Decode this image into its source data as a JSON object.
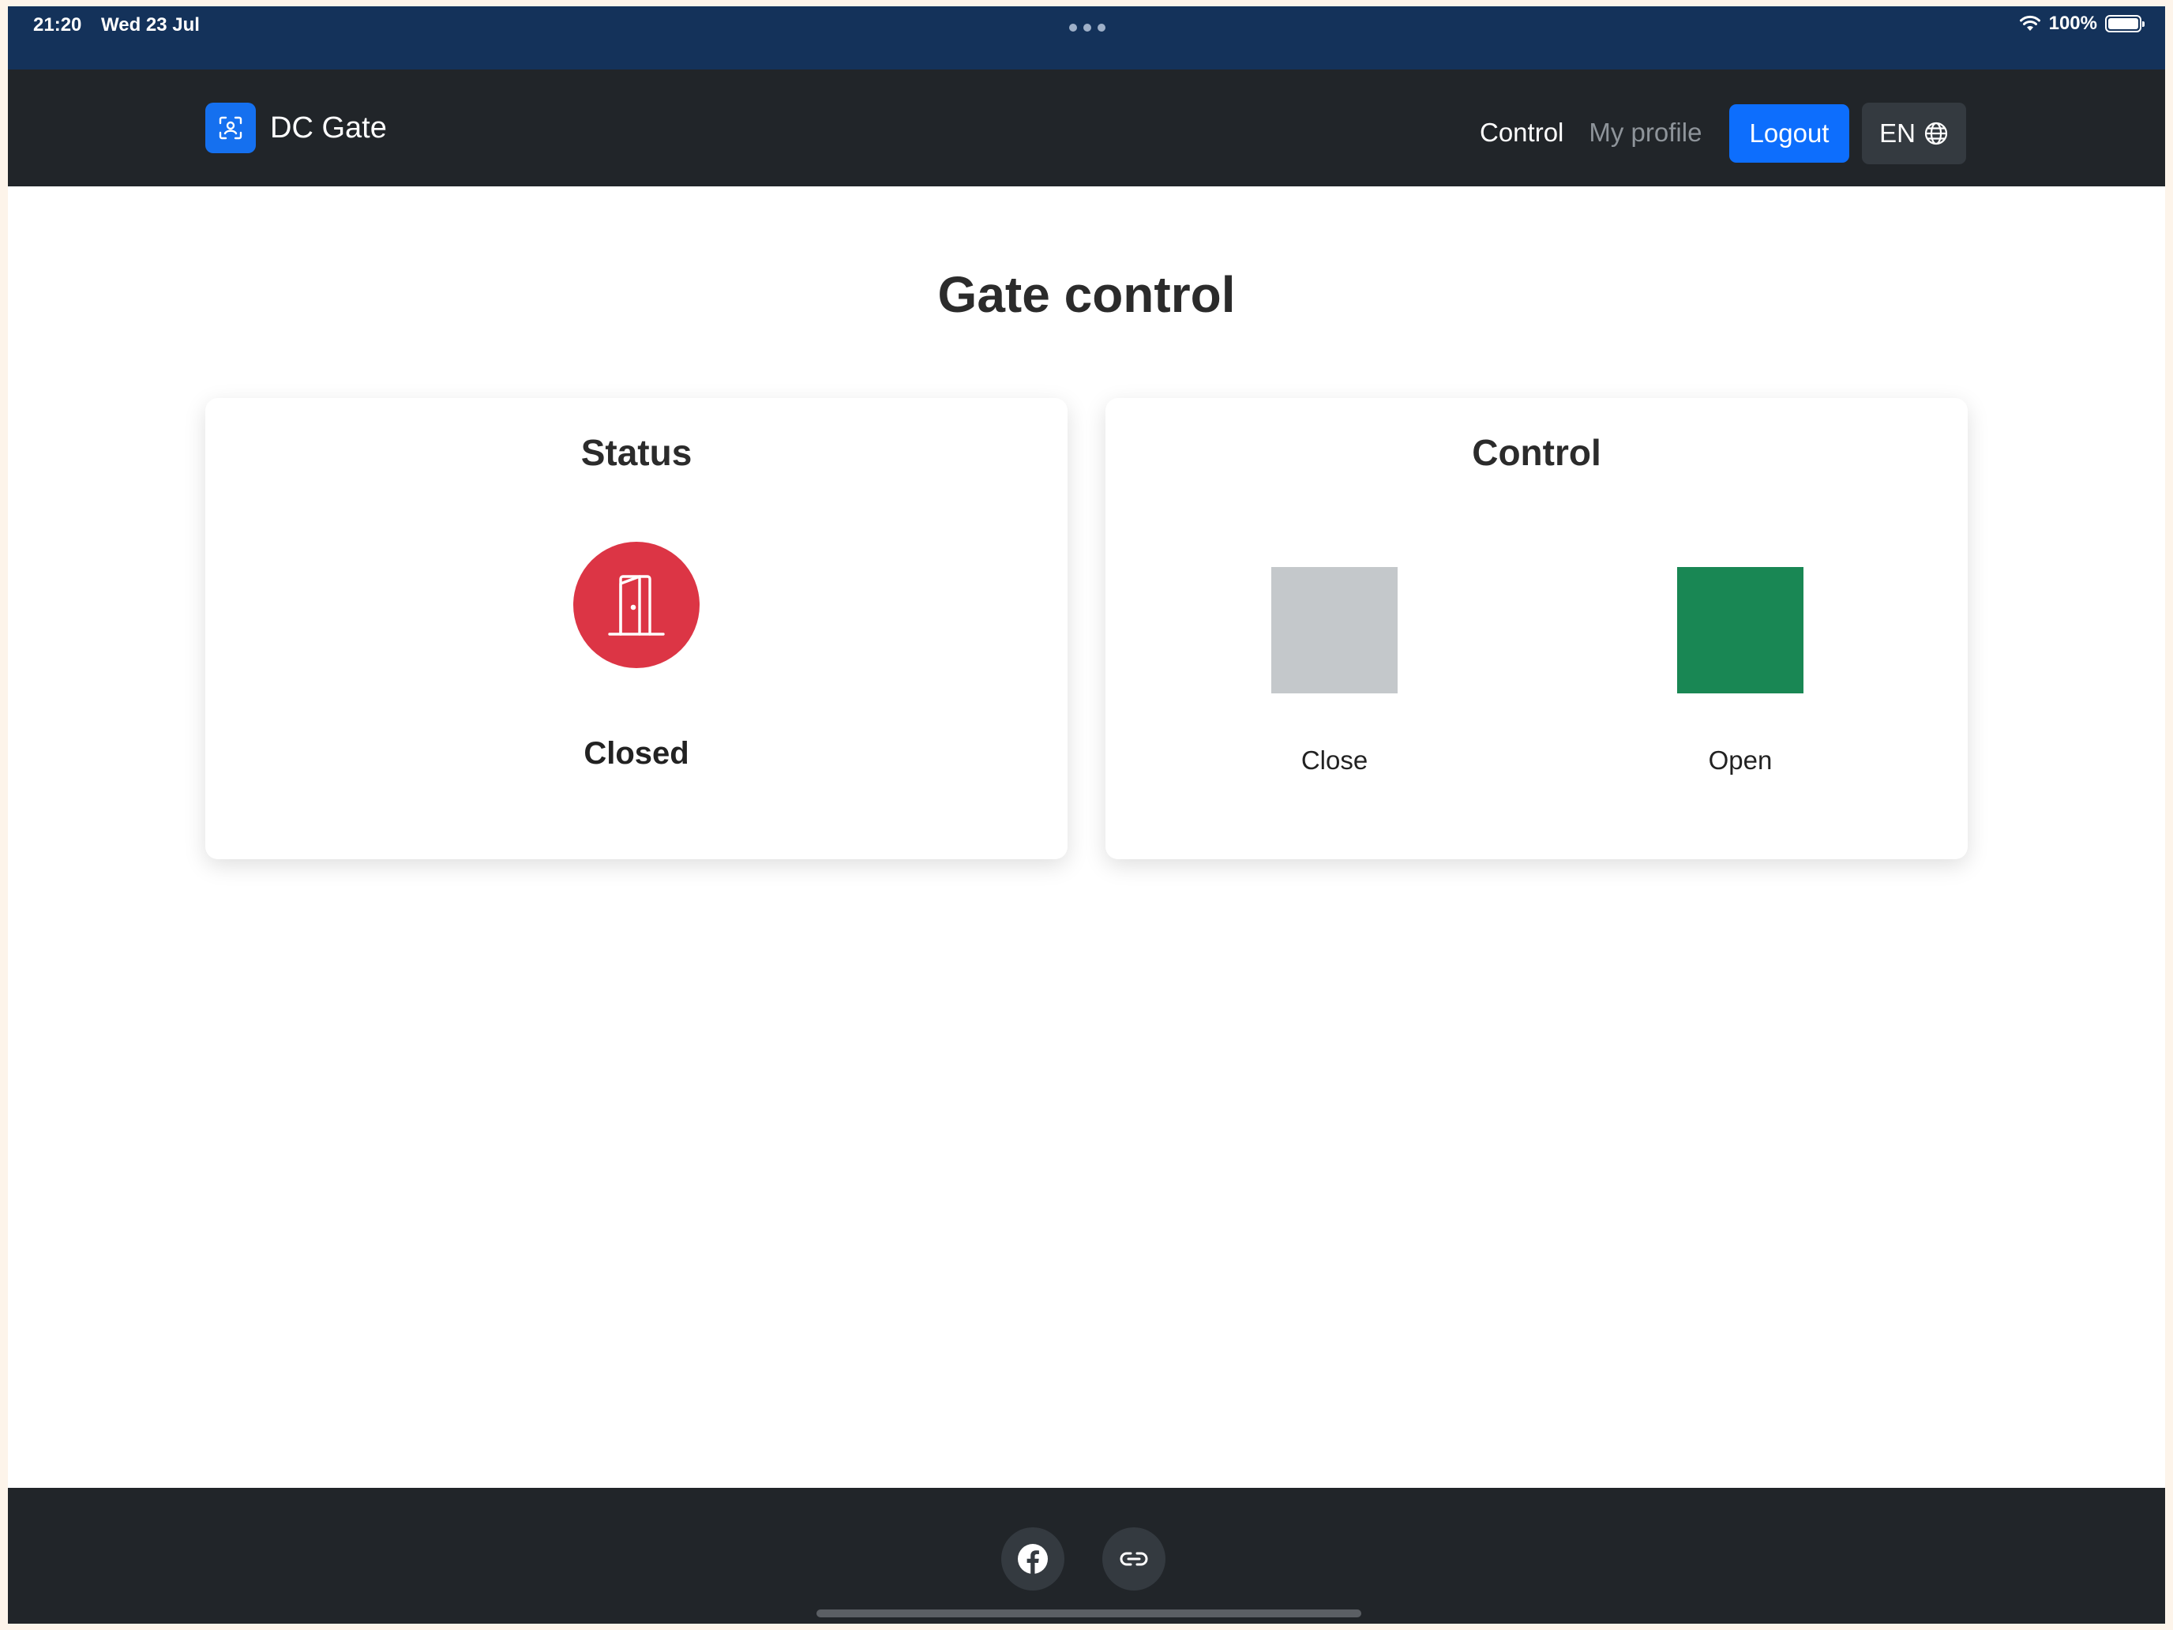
{
  "status_bar": {
    "time": "21:20",
    "date": "Wed 23 Jul",
    "battery": "100%"
  },
  "navbar": {
    "brand": "DC Gate",
    "links": {
      "control": "Control",
      "profile": "My profile"
    },
    "logout_label": "Logout",
    "language": "EN"
  },
  "main": {
    "title": "Gate control",
    "status_card": {
      "title": "Status",
      "state": "Closed"
    },
    "control_card": {
      "title": "Control",
      "close_label": "Close",
      "open_label": "Open"
    }
  },
  "footer": {
    "icons": [
      "facebook-icon",
      "link-icon"
    ]
  },
  "colors": {
    "status_bar": "#14325a",
    "navbar": "#212529",
    "primary": "#0d6efd",
    "danger": "#dc3545",
    "success": "#198754",
    "disabled": "#c4c8cb"
  }
}
